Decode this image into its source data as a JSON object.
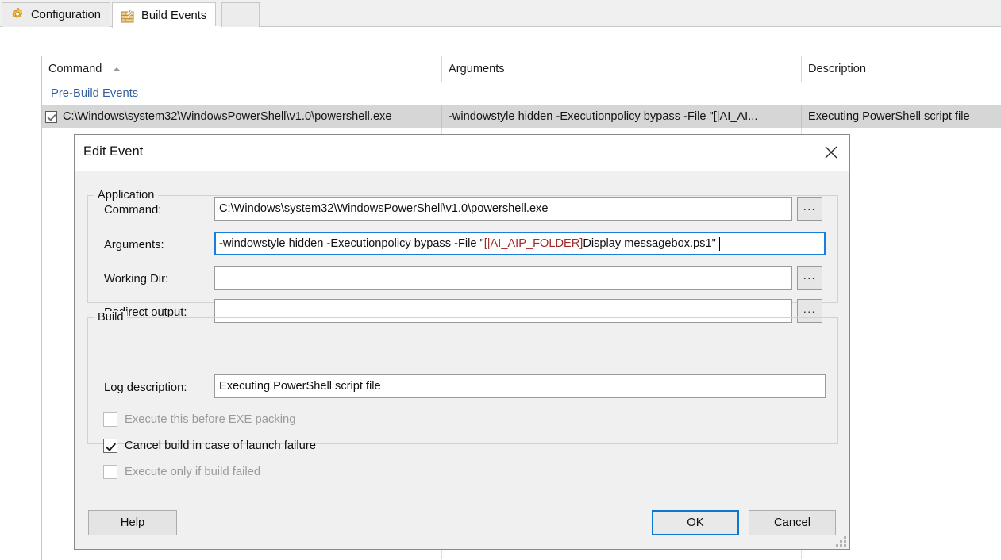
{
  "window": {
    "tabs": [
      {
        "id": "configuration",
        "label": "Configuration",
        "icon": "gear-icon",
        "active": false
      },
      {
        "id": "build-events",
        "label": "Build Events",
        "icon": "brick-lightning-icon",
        "active": true
      }
    ]
  },
  "grid": {
    "columns": [
      {
        "key": "command",
        "label": "Command",
        "sort": "ascending"
      },
      {
        "key": "arguments",
        "label": "Arguments",
        "sort": "none"
      },
      {
        "key": "description",
        "label": "Description",
        "sort": "none"
      }
    ],
    "group_label": "Pre-Build Events",
    "rows": [
      {
        "checked": true,
        "command": "C:\\Windows\\system32\\WindowsPowerShell\\v1.0\\powershell.exe",
        "arguments": "-windowstyle hidden -Executionpolicy bypass -File \"[|AI_AI...",
        "description": "Executing PowerShell script file",
        "selected": true
      }
    ]
  },
  "dialog": {
    "title": "Edit Event",
    "close_icon": "close-icon",
    "application_group": {
      "title": "Application",
      "fields": {
        "command": {
          "label": "Command:",
          "value": "C:\\Windows\\system32\\WindowsPowerShell\\v1.0\\powershell.exe",
          "browse_label": "...",
          "has_browse": true
        },
        "arguments": {
          "label": "Arguments:",
          "value_prefix": "-windowstyle hidden -Executionpolicy bypass -File \"",
          "value_token": "[|AI_AIP_FOLDER]",
          "value_suffix": "Display messagebox.ps1\"",
          "token_color": "#9e2b2b",
          "focused": true,
          "has_browse": false
        },
        "working_dir": {
          "label": "Working Dir:",
          "value": "",
          "browse_label": "...",
          "has_browse": true
        },
        "redirect_output": {
          "label": "Redirect output:",
          "value": "",
          "browse_label": "...",
          "has_browse": true
        }
      }
    },
    "build_group": {
      "title": "Build",
      "log_description": {
        "label": "Log description:",
        "value": "Executing PowerShell script file"
      },
      "checkboxes": [
        {
          "label": "Execute this before EXE packing",
          "checked": false,
          "enabled": false
        },
        {
          "label": "Cancel build in case of launch failure",
          "checked": true,
          "enabled": true
        },
        {
          "label": "Execute only if build failed",
          "checked": false,
          "enabled": false
        }
      ]
    },
    "buttons": {
      "help": "Help",
      "ok": "OK",
      "cancel": "Cancel",
      "default_button": "OK"
    }
  },
  "colors": {
    "accent_blue": "#0f76cd",
    "group_header_blue": "#3560a0",
    "token_red": "#9e2b2b",
    "selected_row": "#d6d6d6",
    "dialog_bg": "#f0f0f0"
  }
}
